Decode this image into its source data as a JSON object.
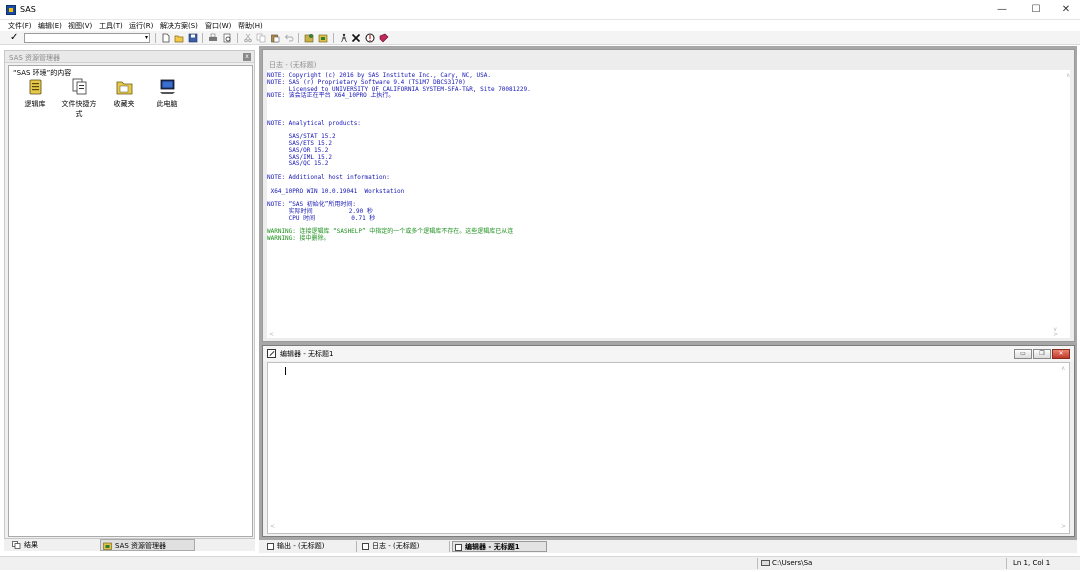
{
  "window": {
    "title": "SAS",
    "minimize_icon": "—",
    "maximize_icon": "☐",
    "close_icon": "✕"
  },
  "menu": [
    "文件(F)",
    "编辑(E)",
    "视图(V)",
    "工具(T)",
    "运行(R)",
    "解决方案(S)",
    "窗口(W)",
    "帮助(H)"
  ],
  "toolbar": {
    "check_icon": "✓",
    "command_value": "",
    "dropdown_icon": "▾"
  },
  "explorer": {
    "panel_title": "SAS 资源管理器",
    "close_icon": "x",
    "heading": "“SAS 环境”的内容",
    "items": [
      {
        "label": "逻辑库",
        "icon": "library-icon"
      },
      {
        "label": "文件快捷方式",
        "icon": "file-shortcut-icon"
      },
      {
        "label": "收藏夹",
        "icon": "favorites-folder-icon"
      },
      {
        "label": "此电脑",
        "icon": "computer-icon"
      }
    ],
    "tabs": [
      {
        "label": "结果",
        "icon": "results-icon"
      },
      {
        "label": "SAS 资源管理器",
        "icon": "explorer-icon"
      }
    ]
  },
  "log": {
    "title": "日志 - (无标题)",
    "lines": [
      {
        "text": "NOTE: Copyright (c) 2016 by SAS Institute Inc., Cary, NC, USA.",
        "type": "note"
      },
      {
        "text": "NOTE: SAS (r) Proprietary Software 9.4 (TS1M7 DBCS3170)",
        "type": "note"
      },
      {
        "text": "      Licensed to UNIVERSITY OF CALIFORNIA SYSTEM-SFA-T&R, Site 70081229.",
        "type": "note"
      },
      {
        "text": "NOTE: 该会话正在平台 X64_10PRO 上执行。",
        "type": "note"
      },
      {
        "text": "",
        "type": "note"
      },
      {
        "text": "",
        "type": "note"
      },
      {
        "text": "",
        "type": "note"
      },
      {
        "text": "NOTE: Analytical products:",
        "type": "note"
      },
      {
        "text": "",
        "type": "note"
      },
      {
        "text": "      SAS/STAT 15.2",
        "type": "note"
      },
      {
        "text": "      SAS/ETS 15.2",
        "type": "note"
      },
      {
        "text": "      SAS/OR 15.2",
        "type": "note"
      },
      {
        "text": "      SAS/IML 15.2",
        "type": "note"
      },
      {
        "text": "      SAS/QC 15.2",
        "type": "note"
      },
      {
        "text": "",
        "type": "note"
      },
      {
        "text": "NOTE: Additional host information:",
        "type": "note"
      },
      {
        "text": "",
        "type": "note"
      },
      {
        "text": " X64_10PRO WIN 10.0.19041  Workstation",
        "type": "note"
      },
      {
        "text": "",
        "type": "note"
      },
      {
        "text": "NOTE: “SAS 初始化”所用时间:",
        "type": "note"
      },
      {
        "text": "      实际时间          2.90 秒",
        "type": "note"
      },
      {
        "text": "      CPU 时间          0.71 秒",
        "type": "note"
      },
      {
        "text": "",
        "type": "note"
      },
      {
        "text": "WARNING: 连接逻辑库 “SASHELP” 中指定的一个或多个逻辑库不存在。这些逻辑库已从连",
        "type": "warning"
      },
      {
        "text": "WARNING: 接中删除。",
        "type": "warning"
      }
    ]
  },
  "editor": {
    "title": "编辑器 - 无标题1",
    "minimize_icon": "▭",
    "restore_icon": "❐",
    "close_icon": "✕"
  },
  "window_tabs": [
    {
      "label": "输出 - (无标题)",
      "active": false
    },
    {
      "label": "日志 - (无标题)",
      "active": false
    },
    {
      "label": "编辑器 - 无标题1",
      "active": true
    }
  ],
  "status": {
    "path": "C:\\Users\\Sa",
    "position": "Ln 1, Col 1"
  }
}
